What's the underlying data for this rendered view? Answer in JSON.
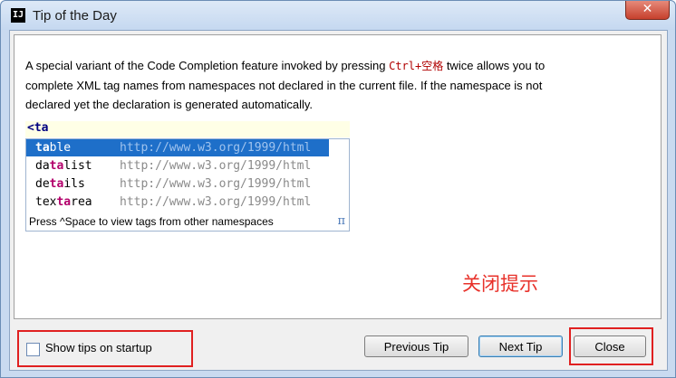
{
  "window": {
    "title": "Tip of the Day",
    "app_icon_text": "IJ",
    "close_glyph": "✕"
  },
  "tip": {
    "line1_pre": "A special variant of the Code Completion feature invoked by pressing ",
    "shortcut": "Ctrl+空格",
    "line1_post": " twice allows you to",
    "line2": "complete XML tag names from namespaces not declared in the current file. If the namespace is not",
    "line3": "declared yet the declaration is generated automatically."
  },
  "code_sample": {
    "typed": "<ta",
    "suggestions": [
      {
        "hl": "ta",
        "rest": "ble",
        "ns": "http://www.w3.org/1999/html"
      },
      {
        "pre": "da",
        "hl": "ta",
        "rest": "list",
        "ns": "http://www.w3.org/1999/html"
      },
      {
        "pre": "de",
        "hl": "ta",
        "rest": "ils",
        "ns": "http://www.w3.org/1999/html"
      },
      {
        "pre": "tex",
        "hl": "ta",
        "rest": "rea",
        "ns": "http://www.w3.org/1999/html"
      }
    ],
    "hint": "Press ^Space to view tags from other namespaces",
    "pi_symbol": "π"
  },
  "annotation": "关闭提示",
  "footer": {
    "show_tips_label": "Show tips on startup",
    "show_tips_checked": false,
    "previous_label": "Previous Tip",
    "next_label": "Next Tip",
    "close_label": "Close"
  },
  "colors": {
    "highlight_box": "#e02020",
    "annotation": "#e8312a",
    "selection": "#1e6fc9"
  }
}
